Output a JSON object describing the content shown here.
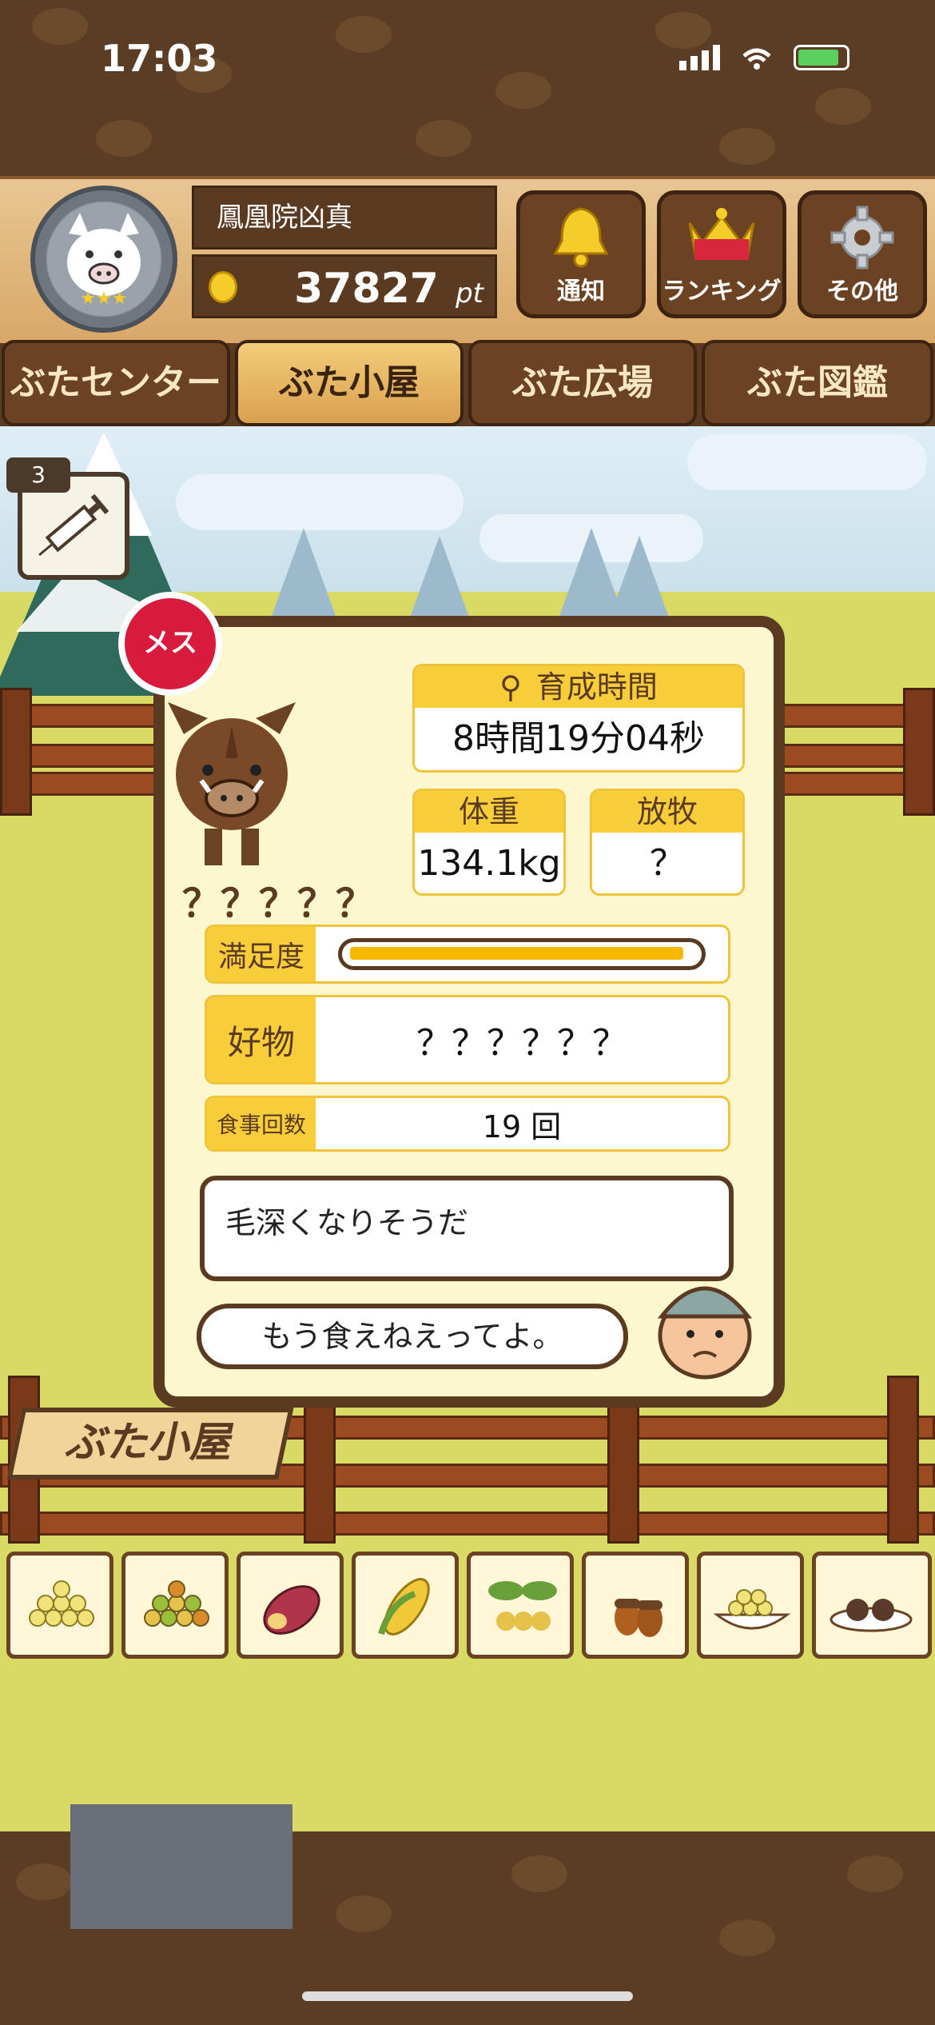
{
  "status_bar": {
    "time": "17:03"
  },
  "header": {
    "player_name": "鳳凰院凶真",
    "points_value": "37827",
    "points_unit": "pt",
    "buttons": [
      {
        "label": "通知",
        "icon": "bell-icon"
      },
      {
        "label": "ランキング",
        "icon": "crown-icon"
      },
      {
        "label": "その他",
        "icon": "gear-icon"
      }
    ]
  },
  "tabs": [
    "ぶたセンター",
    "ぶた小屋",
    "ぶた広場",
    "ぶた図鑑"
  ],
  "active_tab": "ぶた小屋",
  "syringe": {
    "count": "3"
  },
  "card": {
    "gender_badge": "メス",
    "pig_name": "？？？？？",
    "raising_time_label": "育成時間",
    "raising_time_value": "8時間19分04秒",
    "weight_label": "体重",
    "weight_value": "134.1kg",
    "grazing_label": "放牧",
    "grazing_value": "？",
    "satisfaction_label": "満足度",
    "satisfaction_level": 0.97,
    "favorite_label": "好物",
    "favorite_value": "？？？？？？",
    "meals_label": "食事回数",
    "meals_value": "19 回",
    "comment": "毛深くなりそうだ",
    "speech": "もう食えねえってよ。"
  },
  "sign_label": "ぶた小屋",
  "foods": [
    "beans-icon",
    "mixed-beans-icon",
    "sweet-potato-icon",
    "corn-icon",
    "nuts-leaves-icon",
    "acorn-icon",
    "soybeans-bowl-icon",
    "truffle-icon"
  ],
  "colors": {
    "accent": "#f7cd3a",
    "wood_dark": "#5b3a22",
    "female": "#d81b3c"
  }
}
